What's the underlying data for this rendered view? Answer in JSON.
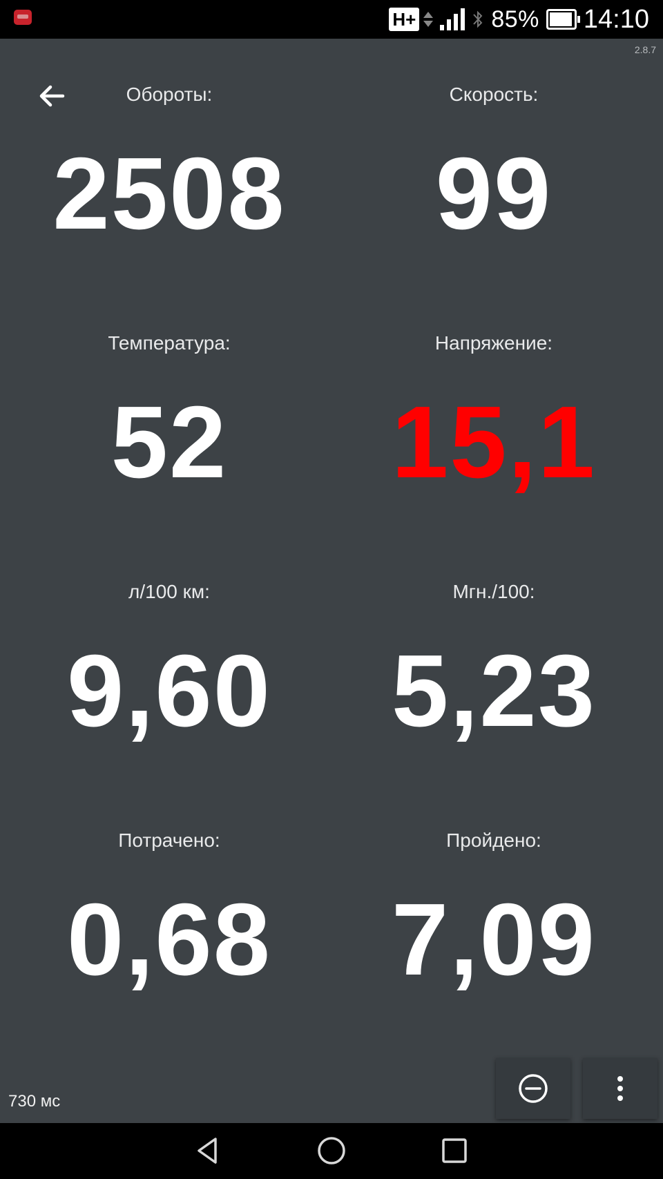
{
  "status_bar": {
    "network_type": "H+",
    "battery_percent": "85%",
    "time": "14:10",
    "icons": [
      "app-notification-icon",
      "data-arrows-icon",
      "signal-icon",
      "bluetooth-icon",
      "battery-icon"
    ]
  },
  "app": {
    "version": "2.8.7",
    "latency": "730 мс",
    "colors": {
      "background": "#3d4246",
      "value": "#ffffff",
      "warning_value": "#ff0000",
      "label": "#e9eaeb"
    },
    "metrics": [
      {
        "label": "Обороты:",
        "value": "2508",
        "warning": false
      },
      {
        "label": "Скорость:",
        "value": "99",
        "warning": false
      },
      {
        "label": "Температура:",
        "value": "52",
        "warning": false
      },
      {
        "label": "Напряжение:",
        "value": "15,1",
        "warning": true
      },
      {
        "label": "л/100 км:",
        "value": "9,60",
        "warning": false
      },
      {
        "label": "Мгн./100:",
        "value": "5,23",
        "warning": false
      },
      {
        "label": "Потрачено:",
        "value": "0,68",
        "warning": false
      },
      {
        "label": "Пройдено:",
        "value": "7,09",
        "warning": false
      }
    ]
  },
  "nav_bar": {
    "icons": [
      "nav-back-icon",
      "nav-home-icon",
      "nav-recent-icon"
    ]
  }
}
